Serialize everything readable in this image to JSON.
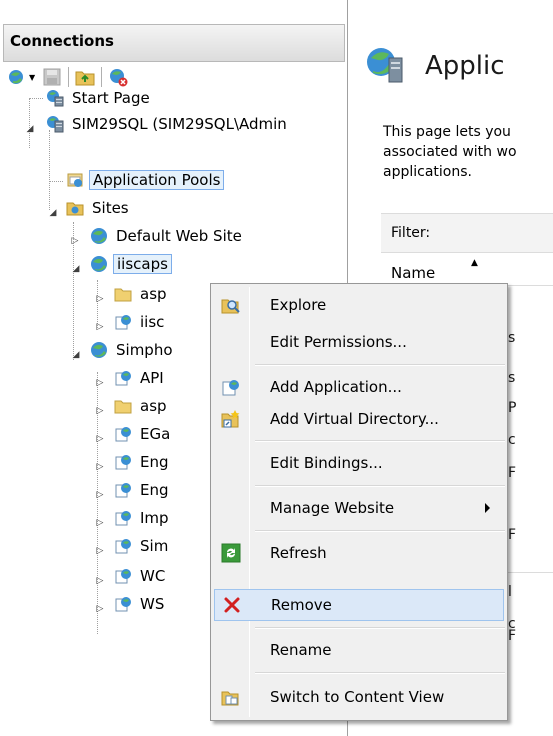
{
  "connections": {
    "header": "Connections",
    "toolbar": [
      "connect-icon",
      "save-icon",
      "up-folder-icon",
      "disconnect-icon"
    ],
    "tree": {
      "start_page": "Start Page",
      "server": "SIM29SQL (SIM29SQL\\Admin",
      "app_pools": "Application Pools",
      "sites": "Sites",
      "default_site": "Default Web Site",
      "iiscaps": "iiscaps",
      "iiscaps_children": [
        "asp",
        "iisc"
      ],
      "simpho": "Simpho",
      "simpho_children": [
        "API",
        "asp",
        "EGa",
        "Eng",
        "Eng",
        "Imp",
        "Sim",
        "WC",
        "WS"
      ]
    }
  },
  "main": {
    "title": "Applic",
    "description": [
      "This page lets you",
      "associated with wo",
      "applications."
    ],
    "filter_label": "Filter:",
    "column_name": "Name",
    "fragments": [
      "s",
      "s",
      "P",
      "c",
      "F",
      "F",
      "l",
      "c",
      "F"
    ]
  },
  "context_menu": {
    "items": {
      "explore": "Explore",
      "edit_permissions": "Edit Permissions...",
      "add_application": "Add Application...",
      "add_virtual_directory": "Add Virtual Directory...",
      "edit_bindings": "Edit Bindings...",
      "manage_website": "Manage Website",
      "refresh": "Refresh",
      "remove": "Remove",
      "rename": "Rename",
      "switch_content_view": "Switch to Content View"
    },
    "highlighted": "Remove"
  },
  "colors": {
    "selection_bg": "#e5f1fb",
    "selection_border": "#7dadea",
    "menu_bg": "#f0f0f0",
    "menu_highlight": "#dbe8f8",
    "remove_icon": "#d22020"
  }
}
